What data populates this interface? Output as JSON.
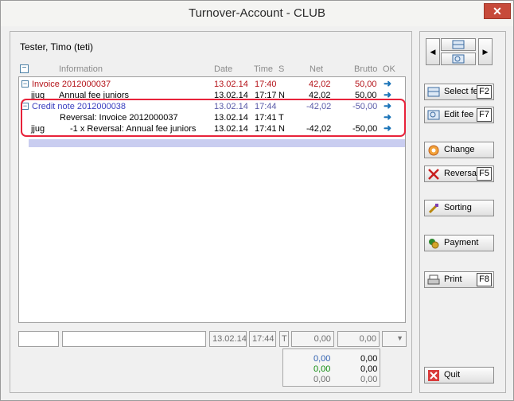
{
  "window": {
    "title": "Turnover-Account - CLUB",
    "close_label": "✕"
  },
  "customer": {
    "name": "Tester, Timo (teti)"
  },
  "grid": {
    "columns": {
      "information": "Information",
      "date": "Date",
      "time": "Time",
      "s": "S",
      "net": "Net",
      "brutto": "Brutto",
      "ok": "OK"
    },
    "rows": [
      {
        "prefix": "",
        "info": "Invoice 2012000037",
        "date": "13.02.14",
        "time": "17:40",
        "s": "",
        "net": "42,02",
        "brutto": "50,00",
        "kind": "header-red"
      },
      {
        "prefix": "jjug",
        "info": "Annual fee juniors",
        "date": "13.02.14",
        "time": "17:17",
        "s": "N",
        "net": "42,02",
        "brutto": "50,00",
        "kind": "item"
      },
      {
        "prefix": "",
        "info": "Credit note 2012000038",
        "date": "13.02.14",
        "time": "17:44",
        "s": "",
        "net": "-42,02",
        "brutto": "-50,00",
        "kind": "header-blue"
      },
      {
        "prefix": "",
        "info": "Reversal: Invoice 2012000037",
        "date": "13.02.14",
        "time": "17:41",
        "s": "T",
        "net": "",
        "brutto": "",
        "kind": "item"
      },
      {
        "prefix": "jjug",
        "info": "-1 x Reversal: Annual fee juniors",
        "date": "13.02.14",
        "time": "17:41",
        "s": "N",
        "net": "-42,02",
        "brutto": "-50,00",
        "kind": "item"
      },
      {
        "prefix": "",
        "info": "",
        "date": "",
        "time": "",
        "s": "",
        "net": "",
        "brutto": "",
        "kind": "selected"
      }
    ]
  },
  "bottom": {
    "date": "13.02.14",
    "time": "17:44",
    "s": "T",
    "net": "0,00",
    "brutto": "0,00"
  },
  "totals": {
    "net_1": "0,00",
    "brutto_1": "0,00",
    "net_2": "0,00",
    "brutto_2": "0,00",
    "net_3": "0,00",
    "brutto_3": "0,00",
    "green_color": "#0a8a0a",
    "blue_color": "#2f5fb0"
  },
  "buttons": {
    "select_fee": "Select fee",
    "select_fee_key": "F2",
    "edit_fee": "Edit fee",
    "edit_fee_key": "F7",
    "change": "Change",
    "reversal": "Reversal",
    "reversal_key": "F5",
    "sorting": "Sorting",
    "payment": "Payment",
    "print": "Print",
    "print_key": "F8",
    "quit": "Quit"
  }
}
